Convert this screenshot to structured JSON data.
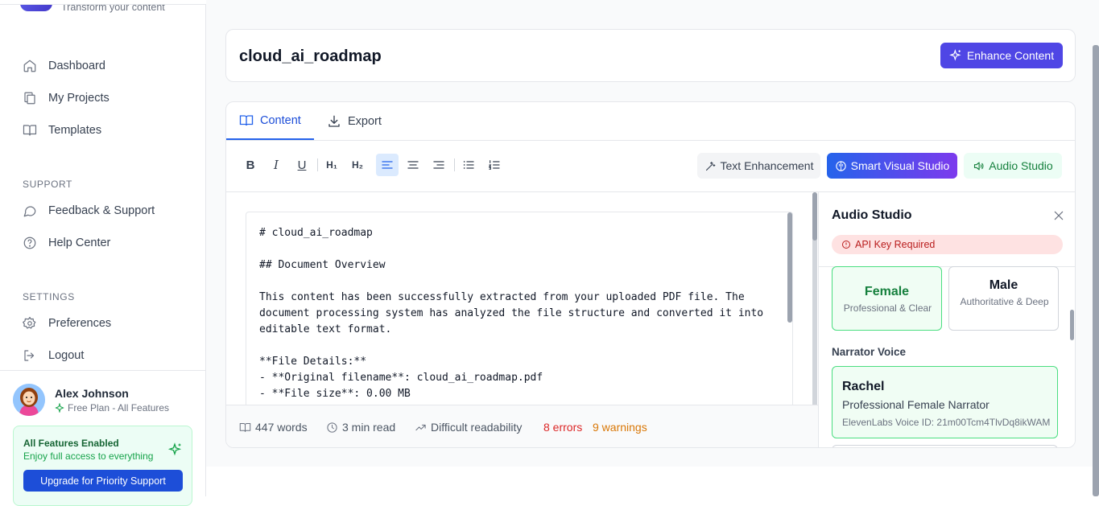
{
  "sidebar": {
    "logo_subtitle": "Transform your content",
    "nav": [
      {
        "label": "Dashboard",
        "icon": "home-icon"
      },
      {
        "label": "My Projects",
        "icon": "copy-icon"
      },
      {
        "label": "Templates",
        "icon": "book-icon"
      }
    ],
    "support_label": "SUPPORT",
    "support": [
      {
        "label": "Feedback & Support",
        "icon": "message-icon"
      },
      {
        "label": "Help Center",
        "icon": "help-circle-icon"
      }
    ],
    "settings_label": "SETTINGS",
    "settings": [
      {
        "label": "Preferences",
        "icon": "gear-icon"
      },
      {
        "label": "Logout",
        "icon": "logout-icon"
      }
    ],
    "user": {
      "name": "Alex Johnson",
      "plan": "Free Plan - All Features"
    },
    "promo": {
      "title": "All Features Enabled",
      "subtitle": "Enjoy full access to everything",
      "button": "Upgrade for Priority Support"
    }
  },
  "header": {
    "title": "cloud_ai_roadmap",
    "enhance_button": "Enhance Content"
  },
  "tabs": [
    {
      "label": "Content",
      "active": true
    },
    {
      "label": "Export",
      "active": false
    }
  ],
  "toolbar": {
    "format_buttons": [
      "bold",
      "italic",
      "underline",
      "heading-1",
      "heading-2",
      "align-left",
      "align-center",
      "align-right",
      "bullet-list",
      "numbered-list"
    ],
    "text_enhancement": "Text Enhancement",
    "smart_visual": "Smart Visual Studio",
    "audio_studio": "Audio Studio"
  },
  "content": {
    "lines": [
      "# cloud_ai_roadmap",
      "",
      "## Document Overview",
      "",
      "This content has been successfully extracted from your uploaded PDF file. The",
      "document processing system has analyzed the file structure and converted it into",
      "editable text format.",
      "",
      "**File Details:**",
      "- **Original filename**: cloud_ai_roadmap.pdf",
      "- **File size**: 0.00 MB"
    ]
  },
  "status": {
    "words": "447 words",
    "read_time": "3 min read",
    "readability": "Difficult readability",
    "errors": "8 errors",
    "warnings": "9 warnings"
  },
  "audio_panel": {
    "title": "Audio Studio",
    "badge": "API Key Required",
    "genders": [
      {
        "name": "Female",
        "desc": "Professional & Clear",
        "selected": true
      },
      {
        "name": "Male",
        "desc": "Authoritative & Deep",
        "selected": false
      }
    ],
    "narrator_label": "Narrator Voice",
    "voice": {
      "name": "Rachel",
      "desc": "Professional Female Narrator",
      "id": "ElevenLabs Voice ID: 21m00Tcm4TlvDq8ikWAM"
    }
  },
  "colors": {
    "primary": "#4f46e5",
    "accent_blue": "#2563eb",
    "success": "#16a34a",
    "error": "#dc2626",
    "warning": "#d97706"
  }
}
